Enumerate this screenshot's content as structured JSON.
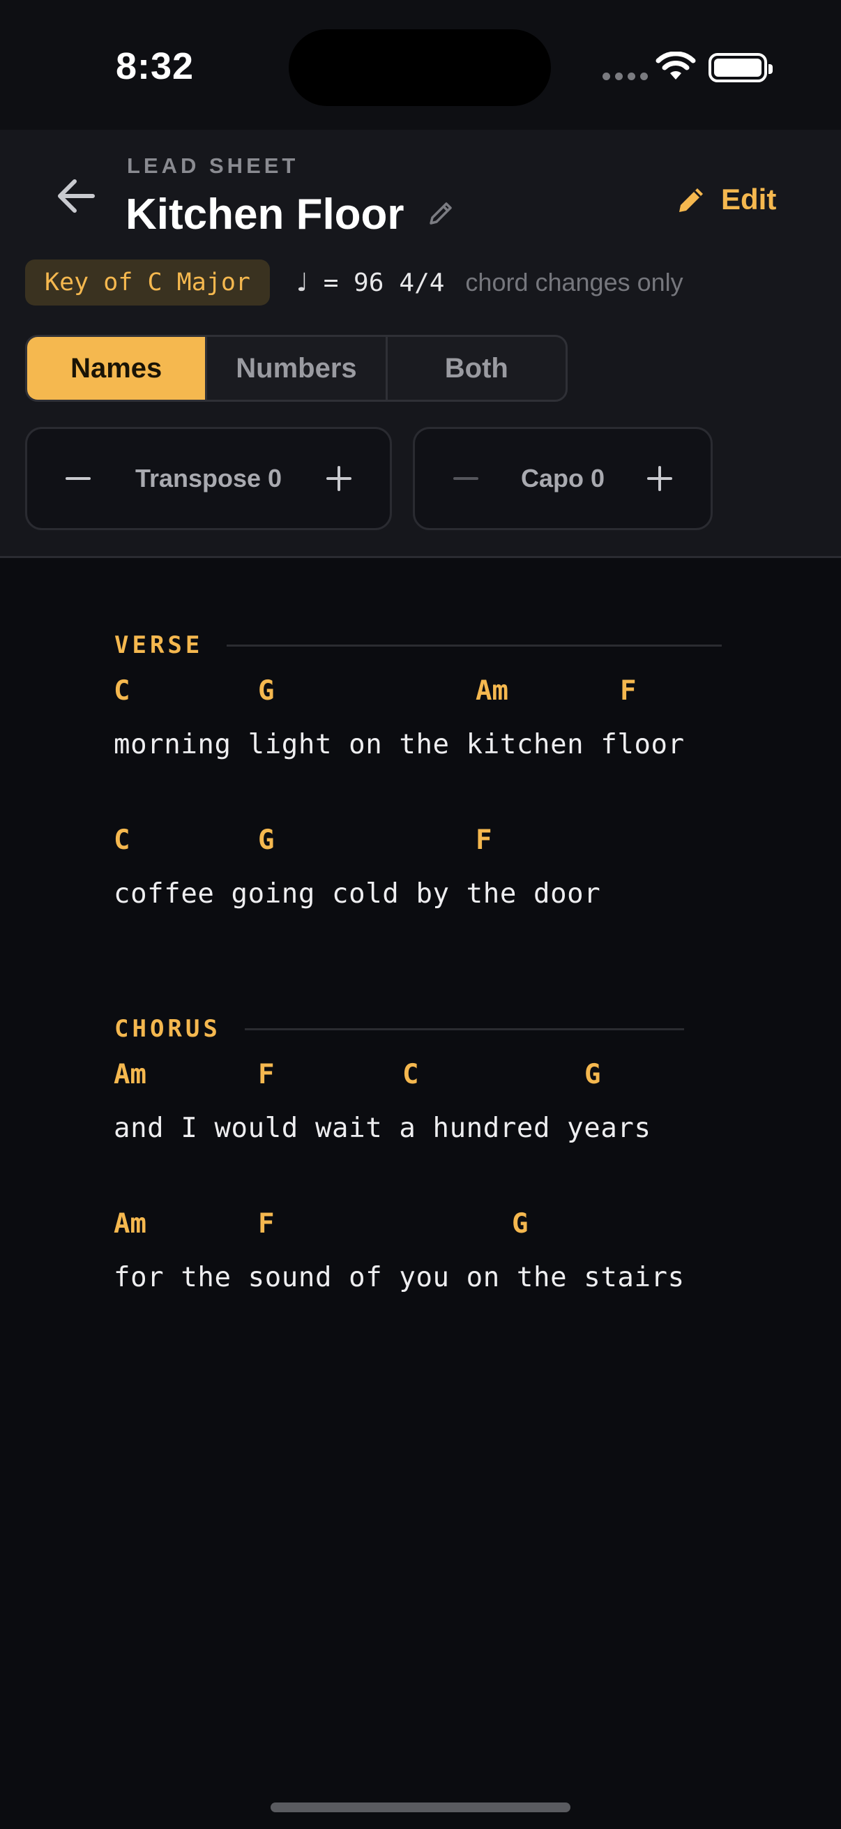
{
  "status": {
    "time": "8:32"
  },
  "header": {
    "eyebrow": "LEAD SHEET",
    "title": "Kitchen Floor",
    "edit_label": "Edit"
  },
  "meta": {
    "key": "Key of C Major",
    "tempo_note": "♩",
    "tempo_value": "= 96",
    "meter": "4/4",
    "note": "chord changes only"
  },
  "view_modes": {
    "options": [
      "Names",
      "Numbers",
      "Both"
    ],
    "selected": "Names"
  },
  "transpose": {
    "label": "Transpose 0",
    "value": 0
  },
  "capo": {
    "label": "Capo 0",
    "value": 0
  },
  "sections": [
    {
      "label": "VERSE",
      "lines": [
        {
          "chords": [
            "C",
            "G",
            "Am",
            "F"
          ],
          "lyric": "morning light on the kitchen floor"
        },
        {
          "chords": [
            "C",
            "G",
            "F"
          ],
          "lyric": "coffee going cold by the door"
        }
      ]
    },
    {
      "label": "CHORUS",
      "lines": [
        {
          "chords": [
            "Am",
            "F",
            "C",
            "G"
          ],
          "lyric": "and I would wait a hundred years"
        },
        {
          "chords": [
            "Am",
            "F",
            "G"
          ],
          "lyric": "for the sound of you on the stairs"
        }
      ]
    }
  ],
  "colors": {
    "accent": "#f5b84f",
    "background": "#0b0c10",
    "header_bg": "#16171c"
  },
  "icons": {
    "back": "arrow-left-icon",
    "title_edit": "pencil-icon",
    "edit": "pencil-icon",
    "minus": "minus-icon",
    "plus": "plus-icon"
  }
}
